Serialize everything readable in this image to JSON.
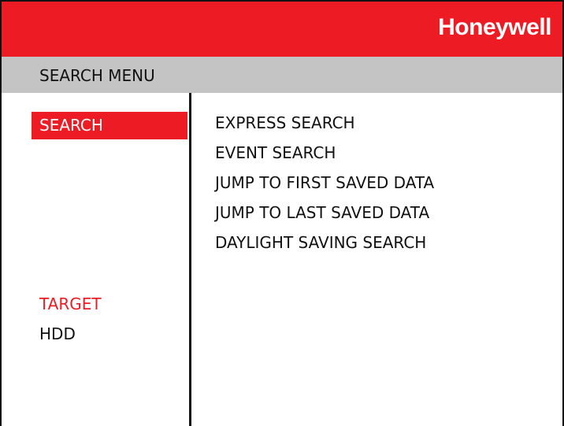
{
  "header": {
    "brand": "Honeywell",
    "colors": {
      "brand_red": "#ed1c24",
      "menu_bar_gray": "#c4c4c4"
    }
  },
  "menu_bar": {
    "title": "SEARCH MENU"
  },
  "left_panel": {
    "selected_tab": "SEARCH",
    "target_label": "TARGET",
    "target_value": "HDD"
  },
  "options": [
    {
      "label": "EXPRESS SEARCH"
    },
    {
      "label": "EVENT SEARCH"
    },
    {
      "label": "JUMP TO FIRST SAVED DATA"
    },
    {
      "label": "JUMP TO LAST SAVED DATA"
    },
    {
      "label": "DAYLIGHT SAVING SEARCH"
    }
  ]
}
